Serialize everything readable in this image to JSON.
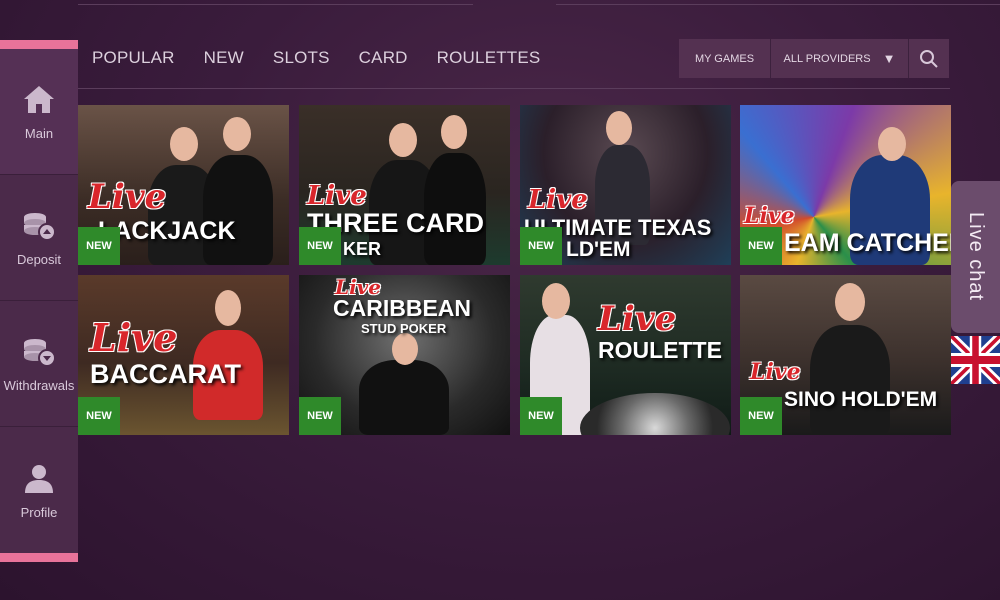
{
  "sidebar": {
    "items": [
      {
        "label": "Main",
        "icon": "home-icon"
      },
      {
        "label": "Deposit",
        "icon": "deposit-coins-icon"
      },
      {
        "label": "Withdrawals",
        "icon": "withdrawal-coins-icon"
      },
      {
        "label": "Profile",
        "icon": "user-icon"
      }
    ]
  },
  "nav": {
    "tabs": [
      "POPULAR",
      "NEW",
      "SLOTS",
      "CARD",
      "ROULETTES"
    ]
  },
  "filters": {
    "my_games": "MY GAMES",
    "providers": "ALL PROVIDERS",
    "caret": "▼"
  },
  "games": [
    {
      "live": "Live",
      "name": "BLACKJACK",
      "shown": "LACKJACK",
      "sub": "",
      "badge": "NEW"
    },
    {
      "live": "Live",
      "name": "THREE CARD POKER",
      "shown": "THREE CARD",
      "sub": "KER",
      "badge": "NEW"
    },
    {
      "live": "Live",
      "name": "ULTIMATE TEXAS HOLD'EM",
      "shown": "ULTIMATE TEXAS",
      "sub": "LD'EM",
      "badge": "NEW"
    },
    {
      "live": "Live",
      "name": "DREAM CATCHER",
      "shown": "EAM CATCHER",
      "sub": "",
      "badge": "NEW"
    },
    {
      "live": "Live",
      "name": "BACCARAT",
      "shown": "BACCARAT",
      "sub": "",
      "badge": "NEW"
    },
    {
      "live": "Live",
      "name": "CARIBBEAN STUD POKER",
      "shown": "CARIBBEAN",
      "sub": "STUD POKER",
      "badge": "NEW"
    },
    {
      "live": "Live",
      "name": "ROULETTE",
      "shown": "ROULETTE",
      "sub": "",
      "badge": "NEW"
    },
    {
      "live": "Live",
      "name": "CASINO HOLD'EM",
      "shown": "SINO HOLD'EM",
      "sub": "",
      "badge": "NEW"
    }
  ],
  "livechat": {
    "label": "Live chat"
  },
  "language": {
    "flag": "uk-flag-icon"
  },
  "colors": {
    "accent_pink": "#e8739a",
    "badge_green": "#2f8a2a",
    "live_red": "#d9262b"
  }
}
